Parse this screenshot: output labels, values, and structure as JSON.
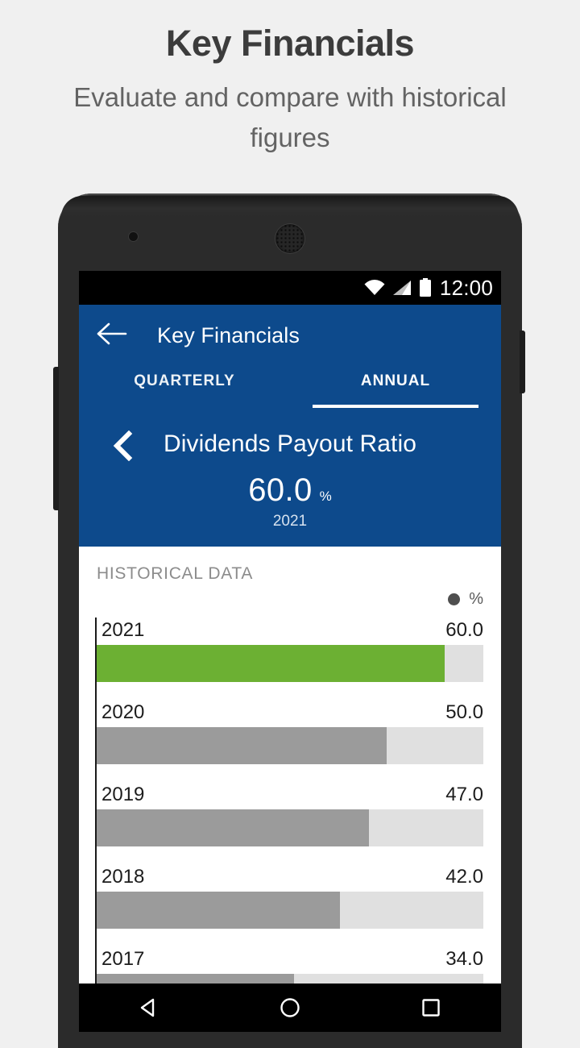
{
  "promo": {
    "title": "Key Financials",
    "subtitle": "Evaluate and compare with historical figures"
  },
  "statusbar": {
    "time": "12:00",
    "wifi_icon": "wifi-icon",
    "signal_icon": "signal-icon",
    "battery_icon": "battery-icon"
  },
  "appbar": {
    "back_icon": "back-arrow-icon",
    "title": "Key Financials",
    "accent_color": "#0d4a8c",
    "tabs": [
      {
        "label": "QUARTERLY",
        "selected": false
      },
      {
        "label": "ANNUAL",
        "selected": true
      }
    ]
  },
  "metric": {
    "prev_icon": "chevron-left-icon",
    "name": "Dividends Payout Ratio",
    "value": "60.0",
    "unit": "%",
    "year": "2021"
  },
  "historical": {
    "title": "HISTORICAL DATA",
    "legend": {
      "dot_color": "#4f4f4f",
      "label": "%"
    }
  },
  "navbar": {
    "back_icon": "nav-back-triangle-icon",
    "home_icon": "nav-home-circle-icon",
    "recents_icon": "nav-recents-square-icon"
  },
  "colors": {
    "highlight_bar": "#6cb033",
    "normal_bar": "#9b9b9b",
    "track": "#e0e0e0"
  },
  "chart_data": {
    "type": "bar",
    "title": "HISTORICAL DATA",
    "xlabel": "",
    "ylabel": "%",
    "orientation": "horizontal",
    "unit": "%",
    "xlim": [
      0,
      66.7
    ],
    "grid": false,
    "legend": [
      "%"
    ],
    "legend_position": "top-right",
    "categories": [
      "2021",
      "2020",
      "2019",
      "2018",
      "2017"
    ],
    "values": [
      60.0,
      50.0,
      47.0,
      42.0,
      34.0
    ],
    "labels": [
      "60.0",
      "50.0",
      "47.0",
      "42.0",
      "34.0"
    ],
    "highlight_index": 0
  }
}
